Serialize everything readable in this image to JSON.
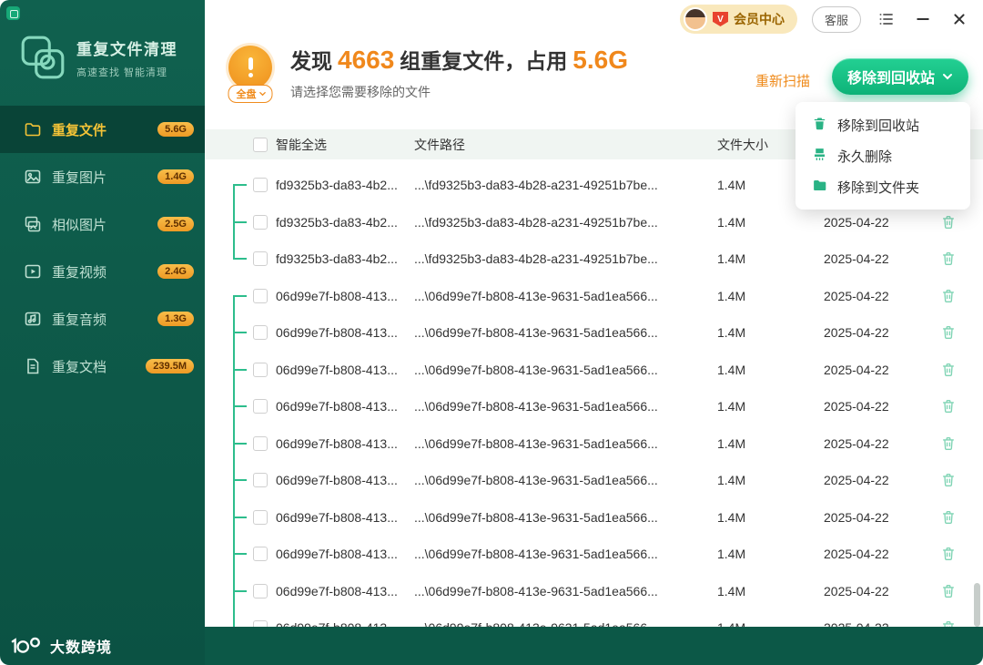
{
  "colors": {
    "accent_green": "#14b87f",
    "accent_orange": "#f0881c",
    "sidebar_bg": "#0d5a49",
    "badge_orange": "#ee9a25"
  },
  "topbar": {
    "member_badge": "V",
    "member_center": "会员中心",
    "customer_service": "客服"
  },
  "sidebar": {
    "app_title": "重复文件清理",
    "app_subtitle": "高速查找 智能清理",
    "items": [
      {
        "label": "重复文件",
        "badge": "5.6G",
        "icon": "files",
        "active": true
      },
      {
        "label": "重复图片",
        "badge": "1.4G",
        "icon": "image",
        "active": false
      },
      {
        "label": "相似图片",
        "badge": "2.5G",
        "icon": "similar",
        "active": false
      },
      {
        "label": "重复视频",
        "badge": "2.4G",
        "icon": "video",
        "active": false
      },
      {
        "label": "重复音频",
        "badge": "1.3G",
        "icon": "audio",
        "active": false
      },
      {
        "label": "重复文档",
        "badge": "239.5M",
        "icon": "doc",
        "active": false
      }
    ],
    "brand": "大数跨境"
  },
  "header": {
    "scope_badge": "全盘",
    "title_prefix": "发现",
    "count": "4663",
    "title_middle": "组重复文件，占用",
    "size": "5.6G",
    "subtitle": "请选择您需要移除的文件",
    "rescan": "重新扫描",
    "primary_action": "移除到回收站"
  },
  "action_menu": {
    "items": [
      {
        "label": "移除到回收站",
        "icon": "trash"
      },
      {
        "label": "永久删除",
        "icon": "shred"
      },
      {
        "label": "移除到文件夹",
        "icon": "folder"
      }
    ]
  },
  "table": {
    "select_all": "智能全选",
    "col_path": "文件路径",
    "col_size": "文件大小",
    "groups": [
      {
        "name": "fd9325b3-da83-4b2...",
        "path": "...\\fd9325b3-da83-4b28-a231-49251b7be...",
        "size": "1.4M",
        "date": "2025-04-22",
        "rows": 3
      },
      {
        "name": "06d99e7f-b808-413...",
        "path": "...\\06d99e7f-b808-413e-9631-5ad1ea566...",
        "size": "1.4M",
        "date": "2025-04-22",
        "rows": 10
      }
    ]
  }
}
